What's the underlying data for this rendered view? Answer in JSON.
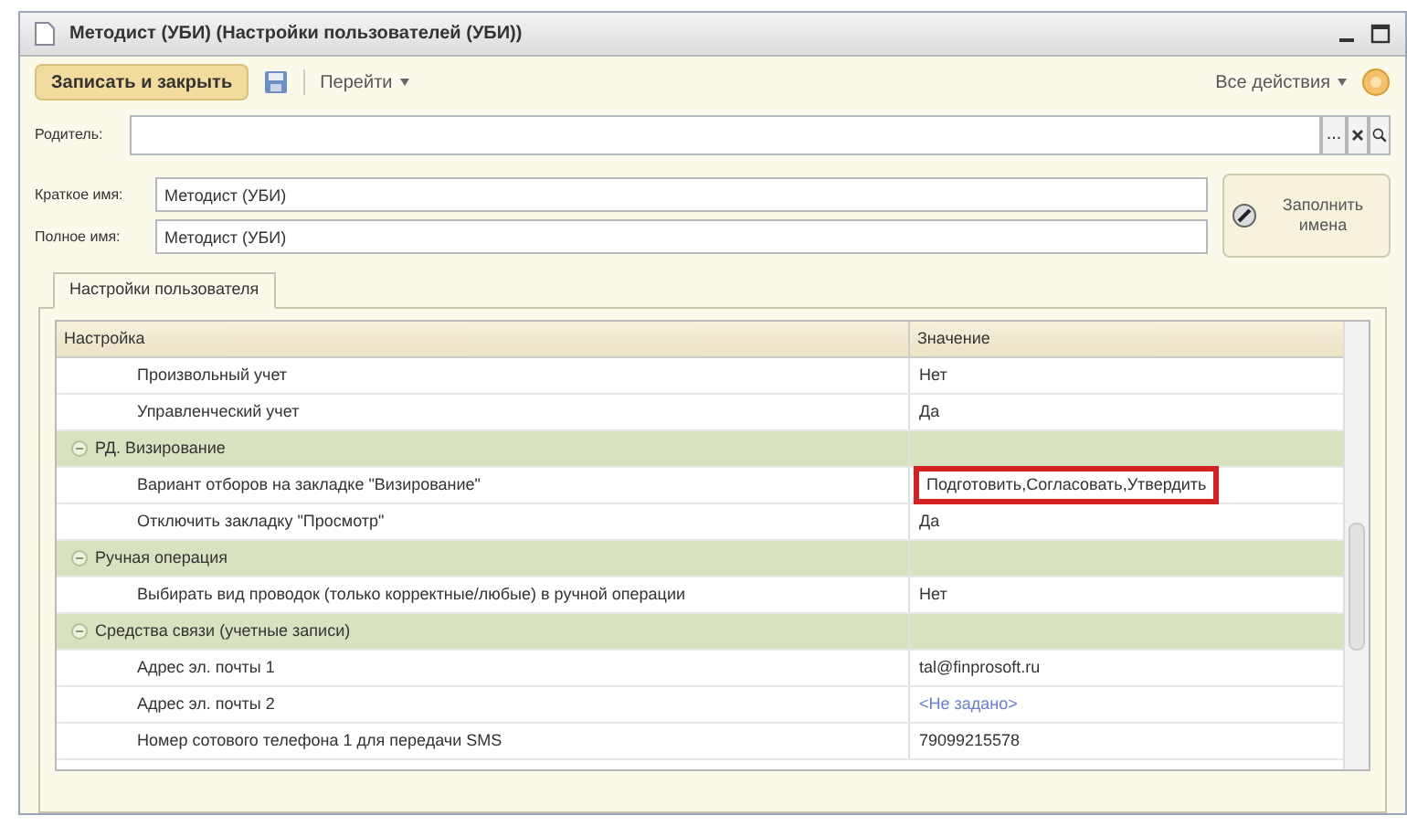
{
  "window": {
    "title": "Методист (УБИ) (Настройки пользователей (УБИ))"
  },
  "toolbar": {
    "save_close": "Записать и закрыть",
    "goto": "Перейти",
    "all_actions": "Все действия"
  },
  "parent": {
    "label": "Родитель:",
    "select_button": "..."
  },
  "short_name": {
    "label": "Краткое имя:",
    "value": "Методист (УБИ)"
  },
  "full_name": {
    "label": "Полное имя:",
    "value": "Методист (УБИ)"
  },
  "fill_names_button": "Заполнить имена",
  "tabs": [
    {
      "label": "Настройки пользователя",
      "selected": true
    }
  ],
  "table": {
    "columns": [
      "Настройка",
      "Значение"
    ],
    "rows": [
      {
        "kind": "setting",
        "name": "Произвольный учет",
        "value": "Нет",
        "unset": false,
        "highlighted": false
      },
      {
        "kind": "setting",
        "name": "Управленческий учет",
        "value": "Да",
        "unset": false,
        "highlighted": false
      },
      {
        "kind": "group",
        "name": "РД. Визирование",
        "expanded": true,
        "children": [
          {
            "kind": "setting",
            "name": "Вариант отборов на закладке \"Визирование\"",
            "value": "Подготовить,Согласовать,Утвердить",
            "unset": false,
            "highlighted": true
          },
          {
            "kind": "setting",
            "name": "Отключить закладку \"Просмотр\"",
            "value": "Да",
            "unset": false,
            "highlighted": false
          }
        ]
      },
      {
        "kind": "group",
        "name": "Ручная операция",
        "expanded": true,
        "children": [
          {
            "kind": "setting",
            "name": "Выбирать вид проводок (только корректные/любые) в ручной операции",
            "value": "Нет",
            "unset": false,
            "highlighted": false
          }
        ]
      },
      {
        "kind": "group",
        "name": "Средства связи (учетные записи)",
        "expanded": true,
        "children": [
          {
            "kind": "setting",
            "name": "Адрес эл. почты 1",
            "value": "tal@finprosoft.ru",
            "unset": false,
            "highlighted": false
          },
          {
            "kind": "setting",
            "name": "Адрес эл. почты 2",
            "value": "<Не задано>",
            "unset": true,
            "highlighted": false
          },
          {
            "kind": "setting",
            "name": "Номер сотового телефона 1 для передачи SMS",
            "value": "79099215578",
            "unset": false,
            "highlighted": false
          }
        ]
      }
    ]
  }
}
